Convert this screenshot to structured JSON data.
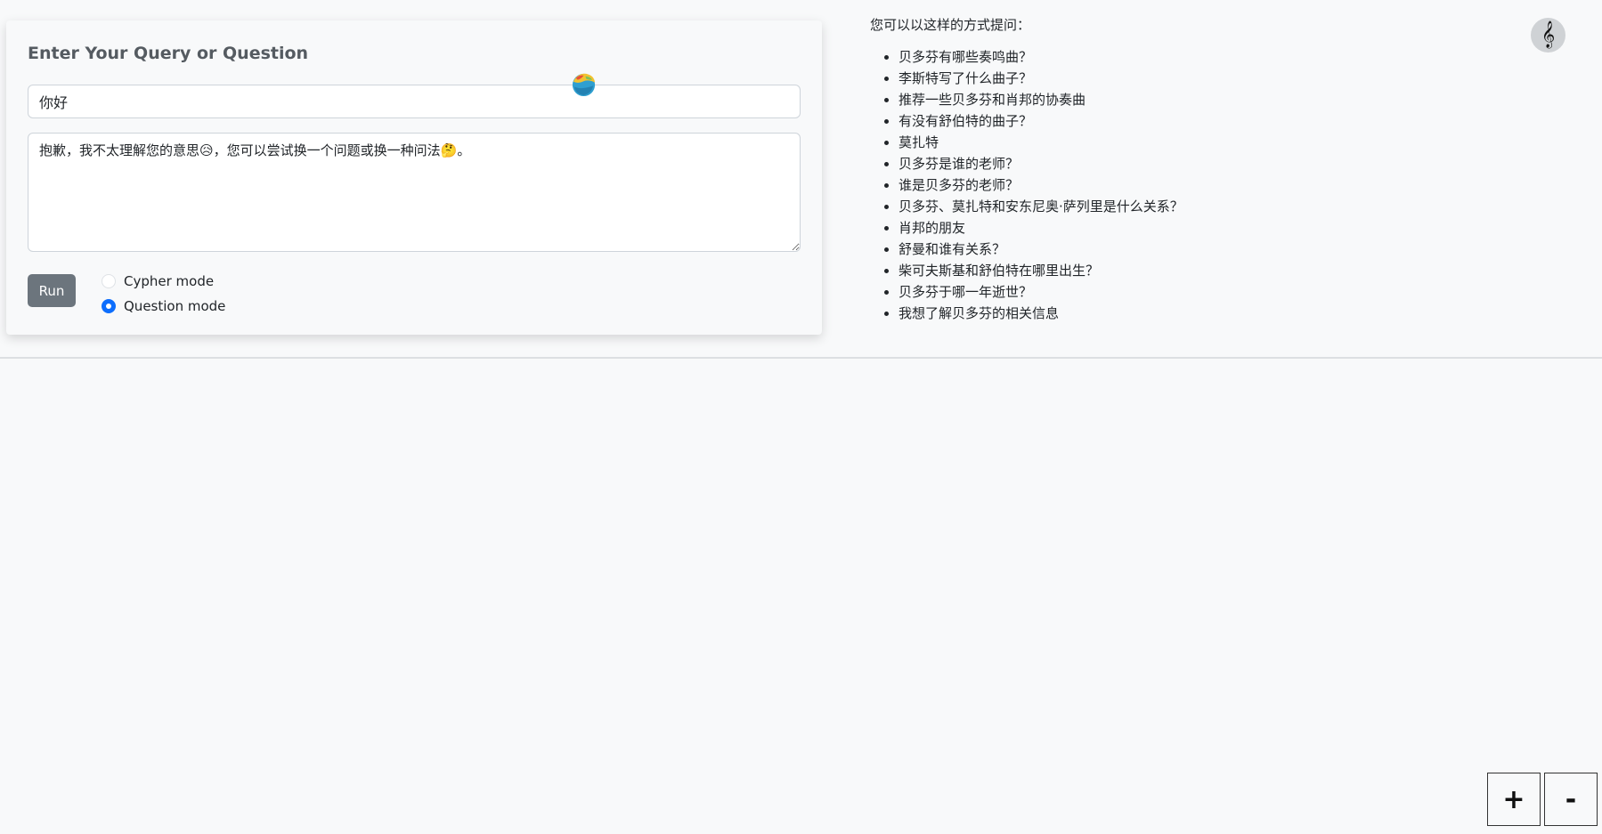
{
  "query_card": {
    "title": "Enter Your Query or Question",
    "query_value": "你好",
    "answer_text": "抱歉，我不太理解您的意思😥，您可以尝试换一个问题或换一种问法🤔。",
    "run_label": "Run",
    "modes": [
      {
        "label": "Cypher mode",
        "checked": false
      },
      {
        "label": "Question mode",
        "checked": true
      }
    ]
  },
  "suggestions": {
    "intro": "您可以以这样的方式提问：",
    "items": [
      "贝多芬有哪些奏鸣曲？",
      "李斯特写了什么曲子？",
      "推荐一些贝多芬和肖邦的协奏曲",
      "有没有舒伯特的曲子？",
      "莫扎特",
      "贝多芬是谁的老师？",
      "谁是贝多芬的老师？",
      "贝多芬、莫扎特和安东尼奥·萨列里是什么关系？",
      "肖邦的朋友",
      "舒曼和谁有关系？",
      "柴可夫斯基和舒伯特在哪里出生？",
      "贝多芬于哪一年逝世？",
      "我想了解贝多芬的相关信息"
    ]
  },
  "icons": {
    "clef": "𝄞",
    "floating": "colorful-globe-icon"
  },
  "zoom": {
    "in_label": "+",
    "out_label": "-"
  },
  "colors": {
    "accent": "#0d6efd",
    "run_button": "#6c757d",
    "background": "#f8f9fa"
  }
}
